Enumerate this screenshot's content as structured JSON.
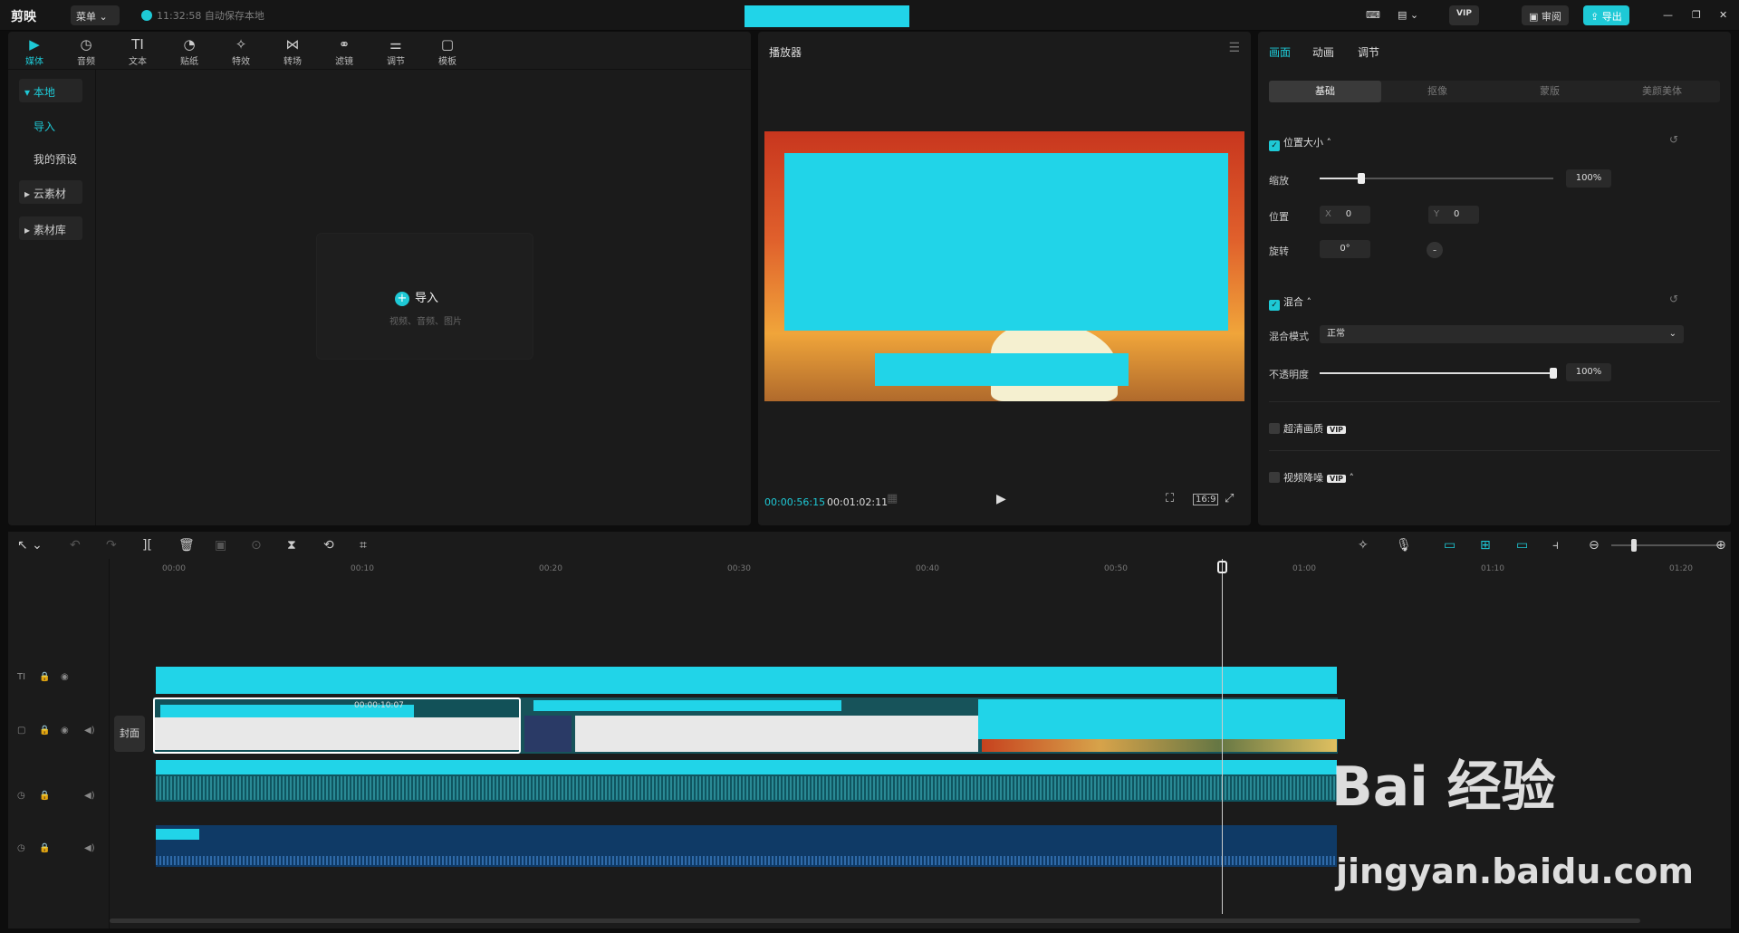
{
  "titlebar": {
    "app_name": "剪映",
    "menu_label": "菜单",
    "autosave_text": "11:32:58 自动保存本地",
    "review_label": "审阅",
    "export_label": "导出",
    "vip_label": "VIP"
  },
  "media_panel": {
    "tabs": [
      {
        "label": "媒体",
        "icon": "media-icon"
      },
      {
        "label": "音频",
        "icon": "audio-icon"
      },
      {
        "label": "文本",
        "icon": "text-icon"
      },
      {
        "label": "贴纸",
        "icon": "sticker-icon"
      },
      {
        "label": "特效",
        "icon": "effects-icon"
      },
      {
        "label": "转场",
        "icon": "transition-icon"
      },
      {
        "label": "滤镜",
        "icon": "filter-icon"
      },
      {
        "label": "调节",
        "icon": "adjust-icon"
      },
      {
        "label": "模板",
        "icon": "template-icon"
      }
    ],
    "sidebar": {
      "local": "本地",
      "import": "导入",
      "my_presets": "我的预设",
      "cloud": "云素材",
      "library": "素材库"
    },
    "import_card": {
      "label": "导入",
      "hint": "视频、音频、图片"
    }
  },
  "player": {
    "title": "播放器",
    "current_time": "00:00:56:15",
    "total_time": "00:01:02:11",
    "aspect": "16:9"
  },
  "properties": {
    "tabs": [
      "画面",
      "动画",
      "调节"
    ],
    "subtabs": [
      "基础",
      "抠像",
      "蒙版",
      "美颜美体"
    ],
    "position_size": "位置大小",
    "scale_label": "缩放",
    "scale_value": "100%",
    "scale_fraction": 0.18,
    "position_label": "位置",
    "x_label": "X",
    "x_value": "0",
    "y_label": "Y",
    "y_value": "0",
    "rotate_label": "旋转",
    "rotate_value": "0°",
    "blend": "混合",
    "blend_mode_label": "混合模式",
    "blend_mode_value": "正常",
    "opacity_label": "不透明度",
    "opacity_value": "100%",
    "opacity_fraction": 1.0,
    "super_resolution": "超清画质",
    "denoise": "视频降噪"
  },
  "timeline": {
    "ticks": [
      "00:00",
      "00:10",
      "00:20",
      "00:30",
      "00:40",
      "00:50",
      "01:00",
      "01:10",
      "01:20"
    ],
    "cover_label": "封面",
    "clip_time": "00:00:10:07"
  },
  "watermark": {
    "brand": "Bai 经验",
    "url": "jingyan.baidu.com"
  },
  "colors": {
    "accent": "#1ec9d6",
    "redaction": "#21d4e8"
  }
}
